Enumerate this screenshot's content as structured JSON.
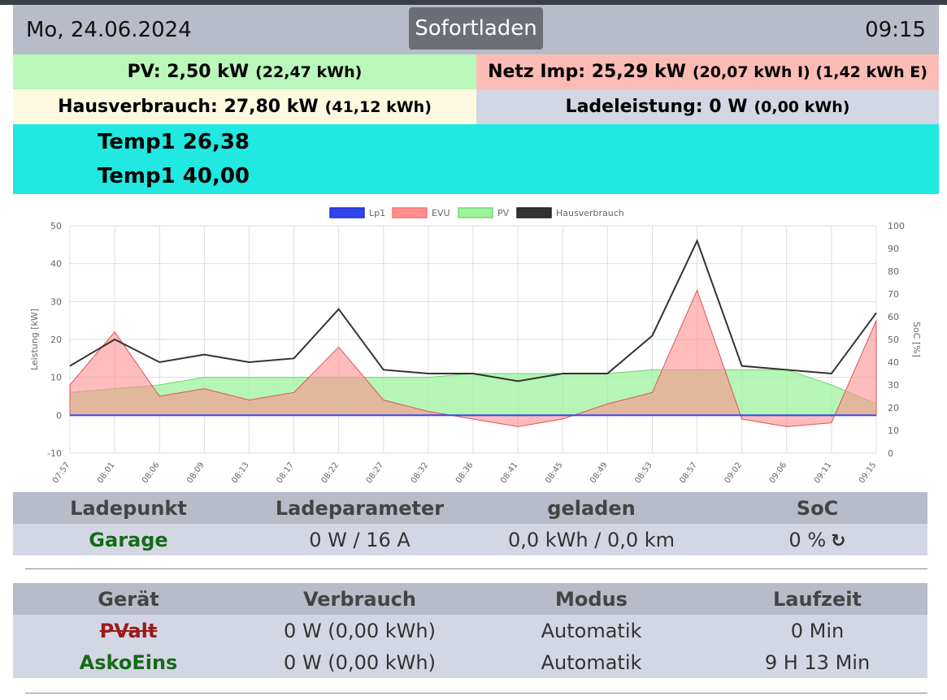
{
  "header": {
    "date": "Mo, 24.06.2024",
    "mode_button": "Sofortladen",
    "time": "09:15"
  },
  "status": {
    "pv_label": "PV: 2,50 kW",
    "pv_energy": "(22,47 kWh)",
    "netz_label": "Netz Imp: 25,29 kW",
    "netz_energy": "(20,07 kWh I) (1,42 kWh E)",
    "haus_label": "Hausverbrauch: 27,80 kW",
    "haus_energy": "(41,12 kWh)",
    "lade_label": "Ladeleistung: 0 W",
    "lade_energy": "(0,00 kWh)"
  },
  "temps": {
    "t1": "Temp1 26,38",
    "t2": "Temp1 40,00"
  },
  "chart_data": {
    "type": "line",
    "legend": [
      "Lp1",
      "EVU",
      "PV",
      "Hausverbrauch"
    ],
    "legend_placement": "top",
    "colors": {
      "Lp1": "#3344ee",
      "EVU": "#ff8f8f",
      "PV": "#9cf29c",
      "Hausverbrauch": "#333333"
    },
    "ylabel": "Leistung [kW]",
    "ylabel_right": "SoC [%]",
    "ylim": [
      -10,
      50
    ],
    "yticks": [
      -10,
      0,
      10,
      20,
      30,
      40,
      50
    ],
    "ylim_right": [
      0,
      100
    ],
    "yticks_right": [
      0,
      10,
      20,
      30,
      40,
      50,
      60,
      70,
      80,
      90,
      100
    ],
    "grid": true,
    "x": [
      "07:57",
      "08:01",
      "08:06",
      "08:09",
      "08:13",
      "08:17",
      "08:22",
      "08:27",
      "08:32",
      "08:36",
      "08:41",
      "08:45",
      "08:49",
      "08:53",
      "08:57",
      "09:02",
      "09:06",
      "09:11",
      "09:15"
    ],
    "series": [
      {
        "name": "Lp1",
        "values": [
          0,
          0,
          0,
          0,
          0,
          0,
          0,
          0,
          0,
          0,
          0,
          0,
          0,
          0,
          0,
          0,
          0,
          0,
          0
        ]
      },
      {
        "name": "EVU",
        "values": [
          8,
          22,
          5,
          7,
          4,
          6,
          18,
          4,
          1,
          -1,
          -3,
          -1,
          3,
          6,
          33,
          -1,
          -3,
          -2,
          25
        ]
      },
      {
        "name": "PV",
        "values": [
          6,
          7,
          8,
          10,
          10,
          10,
          10,
          10,
          10,
          11,
          11,
          11,
          11,
          12,
          12,
          12,
          12,
          8,
          3
        ]
      },
      {
        "name": "Hausverbrauch",
        "values": [
          13,
          20,
          14,
          16,
          14,
          15,
          28,
          12,
          11,
          11,
          9,
          11,
          11,
          21,
          46,
          13,
          12,
          11,
          27
        ]
      }
    ]
  },
  "ladepunkt_table": {
    "headers": [
      "Ladepunkt",
      "Ladeparameter",
      "geladen",
      "SoC"
    ],
    "rows": [
      {
        "name": "Garage",
        "param": "0 W / 16 A",
        "geladen": "0,0 kWh / 0,0 km",
        "soc": "0 %"
      }
    ]
  },
  "geraete_table": {
    "headers": [
      "Gerät",
      "Verbrauch",
      "Modus",
      "Laufzeit"
    ],
    "rows": [
      {
        "name": "PValt",
        "verbrauch": "0 W (0,00 kWh)",
        "modus": "Automatik",
        "laufzeit": "0 Min"
      },
      {
        "name": "AskoEins",
        "verbrauch": "0 W (0,00 kWh)",
        "modus": "Automatik",
        "laufzeit": "9 H 13 Min"
      }
    ]
  }
}
